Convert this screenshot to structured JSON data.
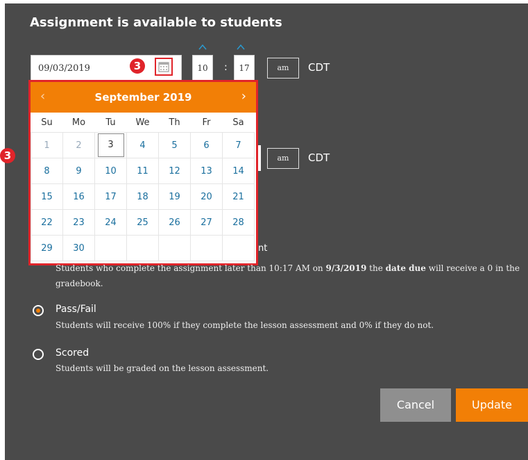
{
  "dialog": {
    "title": "Assignment is available to students"
  },
  "available": {
    "date_value": "09/03/2019",
    "hour": "10",
    "minute": "17",
    "separator": ":",
    "ampm": "am",
    "timezone": "CDT"
  },
  "due": {
    "ampm": "am",
    "timezone": "CDT"
  },
  "callout": {
    "number": "3"
  },
  "calendar": {
    "month_label": "September 2019",
    "prev_glyph": "‹",
    "next_glyph": "›",
    "weekdays": [
      "Su",
      "Mo",
      "Tu",
      "We",
      "Th",
      "Fr",
      "Sa"
    ],
    "weeks": [
      [
        "1",
        "2",
        "3",
        "4",
        "5",
        "6",
        "7"
      ],
      [
        "8",
        "9",
        "10",
        "11",
        "12",
        "13",
        "14"
      ],
      [
        "15",
        "16",
        "17",
        "18",
        "19",
        "20",
        "21"
      ],
      [
        "22",
        "23",
        "24",
        "25",
        "26",
        "27",
        "28"
      ],
      [
        "29",
        "30",
        "",
        "",
        "",
        "",
        ""
      ]
    ],
    "today": "3"
  },
  "late_policy": {
    "heading_tail": "nt",
    "desc_start": "Students who complete the assignment later than 10:17 AM on ",
    "desc_date": "9/3/2019",
    "desc_mid": " the ",
    "desc_bold": "date due",
    "desc_end": " will receive a 0 in the gradebook."
  },
  "grading_options": [
    {
      "title": "Pass/Fail",
      "desc": "Students will receive 100% if they complete the lesson assessment and 0% if they do not.",
      "selected": true
    },
    {
      "title": "Scored",
      "desc": "Students will be graded on the lesson assessment.",
      "selected": false
    }
  ],
  "buttons": {
    "cancel": "Cancel",
    "update": "Update"
  },
  "colors": {
    "panel": "#4a4a4a",
    "accent": "#f27f06",
    "callout": "#e0242a"
  }
}
